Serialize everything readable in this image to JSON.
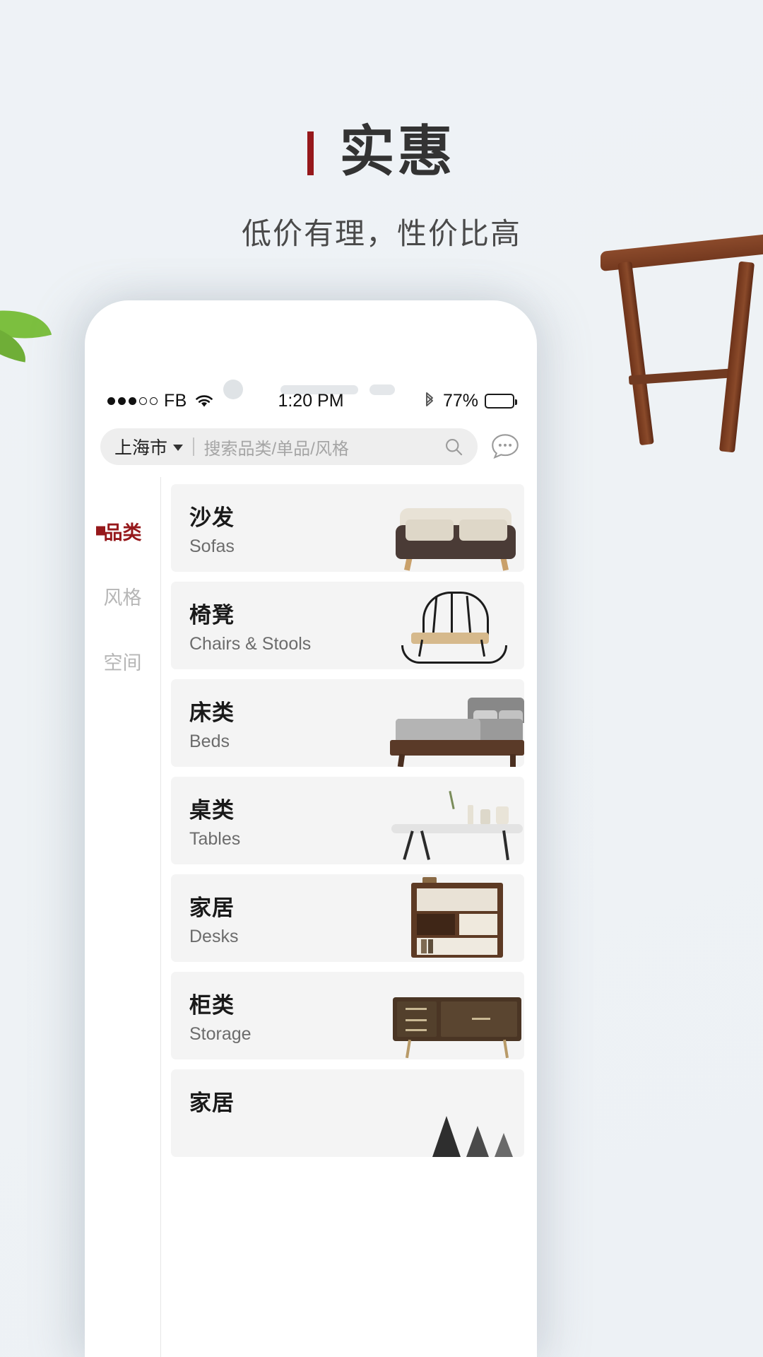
{
  "header": {
    "title": "实惠",
    "subtitle": "低价有理，性价比高",
    "accent_color": "#96181b"
  },
  "phone": {
    "statusbar": {
      "signal_dots_filled": 3,
      "signal_dots_total": 5,
      "carrier": "FB",
      "wifi_icon": "wifi-icon",
      "time": "1:20 PM",
      "bluetooth_icon": "bluetooth-icon",
      "battery_percent": "77%",
      "battery_level": 77
    },
    "search": {
      "city": "上海市",
      "dropdown_icon": "chevron-down-icon",
      "placeholder": "搜索品类/单品/风格",
      "search_icon": "search-icon",
      "chat_icon": "chat-bubble-icon"
    },
    "sidebar": {
      "items": [
        {
          "label": "品类",
          "active": true
        },
        {
          "label": "风格",
          "active": false
        },
        {
          "label": "空间",
          "active": false
        }
      ]
    },
    "categories": [
      {
        "cn": "沙发",
        "en": "Sofas",
        "art": "sofa"
      },
      {
        "cn": "椅凳",
        "en": "Chairs & Stools",
        "art": "chair"
      },
      {
        "cn": "床类",
        "en": "Beds",
        "art": "bed"
      },
      {
        "cn": "桌类",
        "en": "Tables",
        "art": "table"
      },
      {
        "cn": "家居",
        "en": "Desks",
        "art": "shelf"
      },
      {
        "cn": "柜类",
        "en": "Storage",
        "art": "storage"
      },
      {
        "cn": "家居",
        "en": "",
        "art": "decor"
      }
    ]
  }
}
